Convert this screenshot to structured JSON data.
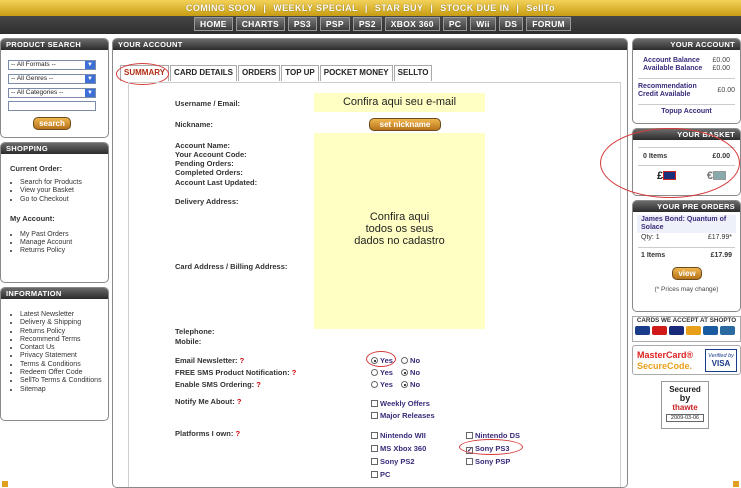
{
  "top_nav": {
    "items": [
      "COMING SOON",
      "WEEKLY SPECIAL",
      "STAR BUY",
      "STOCK DUE IN",
      "SellTo"
    ],
    "sep": "|"
  },
  "main_nav": {
    "items": [
      "HOME",
      "CHARTS",
      "PS3",
      "PSP",
      "PS2",
      "XBOX 360",
      "PC",
      "Wii",
      "DS",
      "FORUM"
    ]
  },
  "product_search": {
    "title": "PRODUCT SEARCH",
    "format": "-- All Formats --",
    "genre": "-- All Genres --",
    "category": "-- All Categories --",
    "search_value": "",
    "button": "search"
  },
  "shopping": {
    "title": "SHOPPING",
    "current_order_heading": "Current Order:",
    "current_order_links": [
      "Search for Products",
      "View your Basket",
      "Go to Checkout"
    ],
    "my_account_heading": "My Account:",
    "my_account_links": [
      "My Past Orders",
      "Manage Account",
      "Returns Policy"
    ]
  },
  "information": {
    "title": "INFORMATION",
    "links": [
      "Latest Newsletter",
      "Delivery & Shipping",
      "Returns Policy",
      "Recommend Terms",
      "Contact Us",
      "Privacy Statement",
      "Terms & Conditions",
      "Redeem Offer Code",
      "SellTo Terms & Conditions",
      "Sitemap"
    ]
  },
  "main": {
    "title": "YOUR ACCOUNT",
    "tabs": [
      "SUMMARY",
      "CARD DETAILS",
      "ORDERS",
      "TOP UP",
      "POCKET MONEY",
      "SELLTO"
    ],
    "labels": {
      "username": "Username / Email:",
      "nickname": "Nickname:",
      "account_name": "Account Name:",
      "account_code": "Your Account Code:",
      "pending": "Pending Orders:",
      "completed": "Completed Orders:",
      "last_updated": "Account Last Updated:",
      "delivery": "Delivery Address:",
      "card_address": "Card Address / Billing Address:",
      "telephone": "Telephone:",
      "mobile": "Mobile:",
      "newsletter": "Email Newsletter:",
      "sms_notify": "FREE SMS Product Notification:",
      "sms_order": "Enable SMS Ordering:",
      "notify_about": "Notify Me About:",
      "platforms": "Platforms I own:"
    },
    "req": "?",
    "note_email": "Confira aqui seu e-mail",
    "note_data_1": "Confira aqui",
    "note_data_2": "todos os seus",
    "note_data_3": "dados no cadastro",
    "set_nickname": "set nickname",
    "yes": "Yes",
    "no": "No",
    "notify_options": [
      "Weekly Offers",
      "Major Releases"
    ],
    "platforms": {
      "nintendo_wii": "Nintendo WII",
      "nintendo_ds": "Nintendo DS",
      "ms_xbox": "MS Xbox 360",
      "sony_ps3": "Sony PS3",
      "sony_ps2": "Sony PS2",
      "sony_psp": "Sony PSP",
      "pc": "PC"
    }
  },
  "your_account": {
    "title": "YOUR ACCOUNT",
    "account_balance": "Account Balance",
    "available_balance": "Available Balance",
    "account_balance_value": "£0.00",
    "available_balance_value": "£0.00",
    "recommendation_credit": "Recommendation Credit Available",
    "recommendation_value": "£0.00",
    "topup": "Topup Account"
  },
  "basket": {
    "title": "YOUR BASKET",
    "items": "0 Items",
    "total": "£0.00",
    "gbp": "£",
    "eur": "€"
  },
  "preorders": {
    "title": "YOUR PRE ORDERS",
    "product": "James Bond: Quantum of Solace",
    "qty": "Qty: 1",
    "price": "£17.99*",
    "items": "1 Items",
    "total": "£17.99",
    "view_button": "view",
    "note": "(* Prices may change)"
  },
  "cards_accepted": {
    "title": "CARDS WE ACCEPT AT SHOPTO",
    "colors": [
      "#1a3a8a",
      "#d01a1a",
      "#1a2a7a",
      "#e8a01a",
      "#1a5aa0",
      "#2a6aa0"
    ]
  },
  "securecode": {
    "brand": "MasterCard®",
    "brand_sub": "SecureCode.",
    "verified": "Verified by",
    "visa": "VISA"
  },
  "thawte": {
    "secured": "Secured",
    "by": "by",
    "name": "thawte",
    "date": "2009-03-06"
  }
}
